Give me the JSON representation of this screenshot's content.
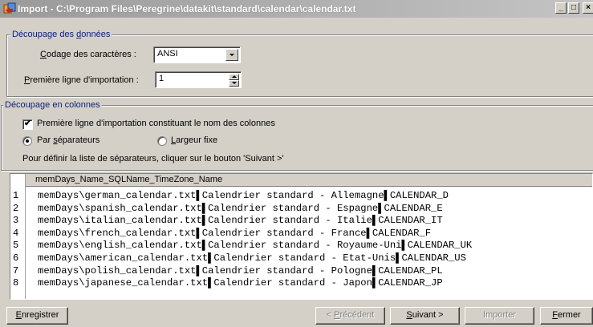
{
  "window": {
    "title": "Import - C:\\Program Files\\Peregrine\\datakit\\standard\\calendar\\calendar.txt",
    "minimize_glyph": "_",
    "maximize_glyph": "□",
    "close_glyph": "×"
  },
  "data_split": {
    "title_pre": "Découpage des ",
    "title_key": "d",
    "title_post": "onnées",
    "encoding_label_key": "C",
    "encoding_label_rest": "odage des caractères :",
    "encoding_value": "ANSI",
    "first_line_label_key": "P",
    "first_line_label_rest": "remière ligne d'importation :",
    "first_line_value": "1"
  },
  "column_split": {
    "title": "Découpage en colonnes",
    "header_checkbox_label": "Première ligne d'importation constituant le nom des colonnes",
    "header_checkbox_checked": true,
    "radio_separators_pre": "Par ",
    "radio_separators_key": "s",
    "radio_separators_post": "éparateurs",
    "radio_separators_selected": true,
    "radio_fixed_key": "L",
    "radio_fixed_rest": "argeur fixe",
    "radio_fixed_selected": false,
    "hint": "Pour définir la liste de séparateurs, cliquer sur le bouton 'Suivant >'"
  },
  "preview": {
    "column_header": "memDays_Name_SQLName_TimeZone_Name",
    "rows": [
      {
        "num": "1",
        "text": "memDays\\german_calendar.txt▌Calendrier standard - Allemagne▌CALENDAR_D"
      },
      {
        "num": "2",
        "text": "memDays\\spanish_calendar.txt▌Calendrier standard - Espagne▌CALENDAR_E"
      },
      {
        "num": "3",
        "text": "memDays\\italian_calendar.txt▌Calendrier standard - Italie▌CALENDAR_IT"
      },
      {
        "num": "4",
        "text": "memDays\\french_calendar.txt▌Calendrier standard - France▌CALENDAR_F"
      },
      {
        "num": "5",
        "text": "memDays\\english_calendar.txt▌Calendrier standard - Royaume-Uni▌CALENDAR_UK"
      },
      {
        "num": "6",
        "text": "memDays\\american_calendar.txt▌Calendrier standard - Etat-Unis▌CALENDAR_US"
      },
      {
        "num": "7",
        "text": "memDays\\polish_calendar.txt▌Calendrier standard - Pologne▌CALENDAR_PL"
      },
      {
        "num": "8",
        "text": "memDays\\japanese_calendar.txt▌Calendrier standard - Japon▌CALENDAR_JP"
      }
    ]
  },
  "buttons": {
    "save_key": "E",
    "save_rest": "nregistrer",
    "previous_pre": "< ",
    "previous_key": "P",
    "previous_rest": "récédent",
    "next_key": "S",
    "next_rest": "uivant >",
    "import": "Importer",
    "close_key": "F",
    "close_rest": "ermer"
  },
  "colors": {
    "dialog_bg": "#d4d0c8",
    "group_title": "#0a1f7a",
    "disabled_text": "#808080"
  },
  "icons": {
    "title": "import-app-icon",
    "checkbox": "checkmark-icon",
    "dropdown": "chevron-down-icon",
    "spinner": "spin-arrows-icon"
  }
}
